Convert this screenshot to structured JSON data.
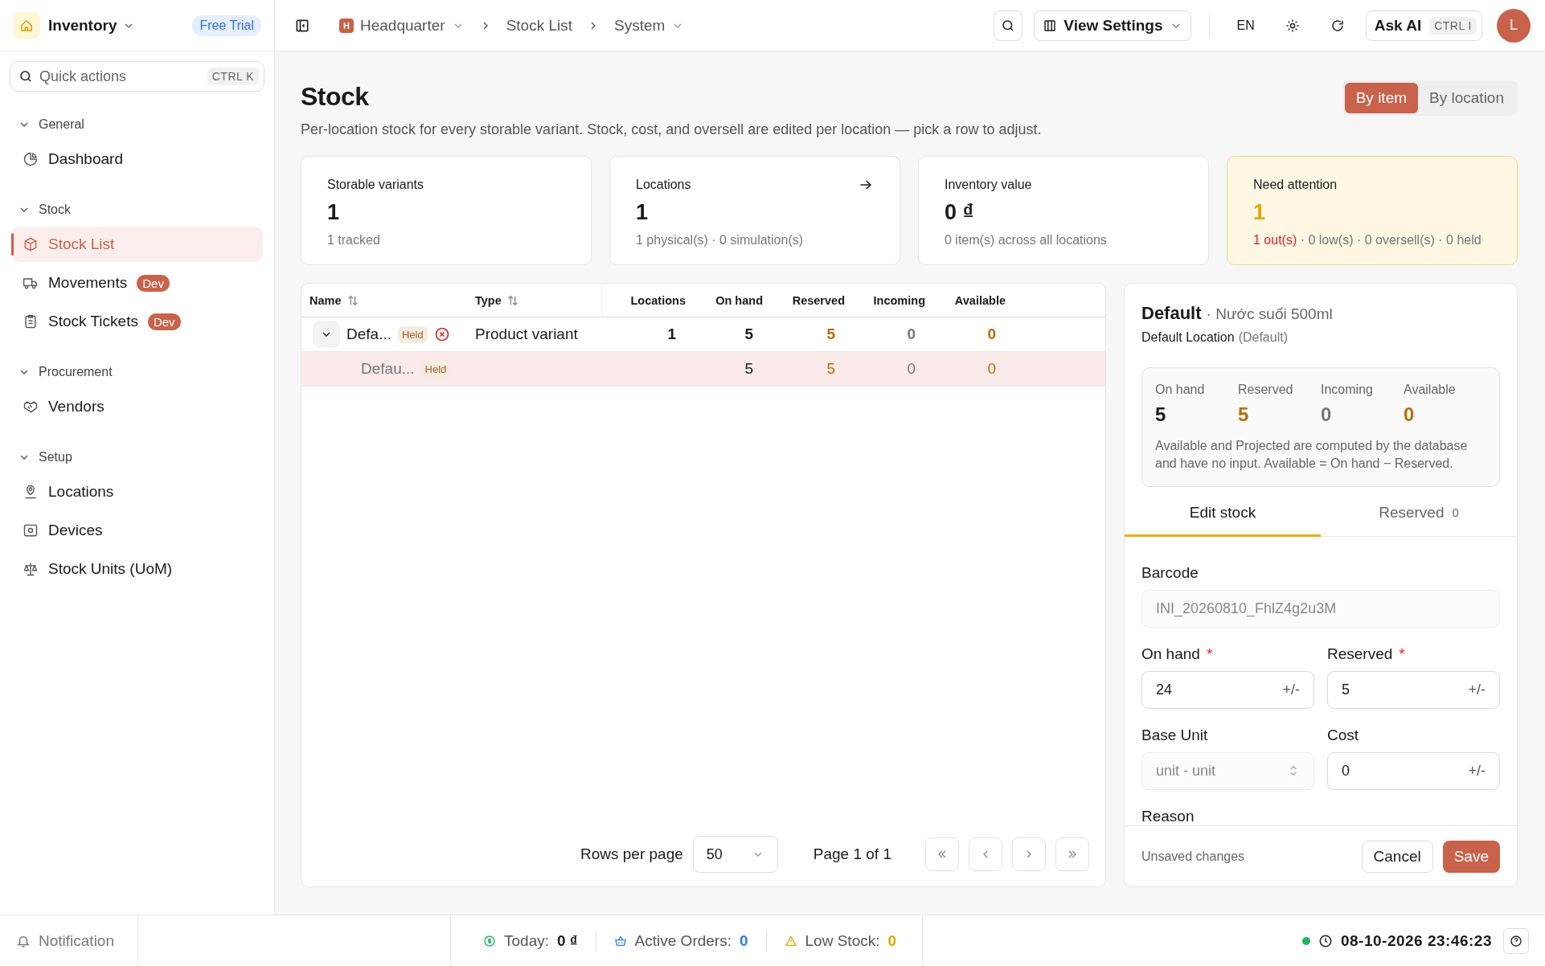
{
  "sidebar": {
    "app": {
      "name": "Inventory",
      "badge": "Free Trial"
    },
    "quick_actions": {
      "placeholder": "Quick actions",
      "shortcut": "CTRL K"
    },
    "sections": [
      {
        "title": "General",
        "expanded": true,
        "items": [
          {
            "label": "Dashboard",
            "selected": false
          }
        ]
      },
      {
        "title": "Stock",
        "expanded": true,
        "items": [
          {
            "label": "Stock List",
            "selected": true
          },
          {
            "label": "Movements",
            "badge": "Dev",
            "selected": false
          },
          {
            "label": "Stock Tickets",
            "badge": "Dev",
            "selected": false
          }
        ]
      },
      {
        "title": "Procurement",
        "expanded": true,
        "items": [
          {
            "label": "Vendors",
            "selected": false
          }
        ]
      },
      {
        "title": "Setup",
        "expanded": true,
        "items": [
          {
            "label": "Locations",
            "selected": false
          },
          {
            "label": "Devices",
            "selected": false
          },
          {
            "label": "Stock Units (UoM)",
            "selected": false
          }
        ]
      }
    ]
  },
  "topbar": {
    "breadcrumbs": [
      {
        "label": "Headquarter",
        "badge": "H",
        "dropdown": true
      },
      {
        "label": "Stock List",
        "dropdown": false
      },
      {
        "label": "System",
        "dropdown": true
      }
    ],
    "view_settings": "View Settings",
    "language": "EN",
    "ask_ai": {
      "label": "Ask AI",
      "shortcut": "CTRL I"
    },
    "avatar": "L"
  },
  "page": {
    "title": "Stock",
    "subtitle": "Per-location stock for every storable variant. Stock, cost, and oversell are edited per location — pick a row to adjust.",
    "view_toggle": [
      {
        "label": "By item",
        "selected": true
      },
      {
        "label": "By location",
        "selected": false
      }
    ]
  },
  "cards": [
    {
      "label": "Storable variants",
      "value": "1",
      "detail": "1 tracked",
      "link": false,
      "attention": false
    },
    {
      "label": "Locations",
      "value": "1",
      "detail": "1 physical(s) · 0 simulation(s)",
      "link": true,
      "attention": false
    },
    {
      "label": "Inventory value",
      "value": "0 ₫",
      "detail": "0 item(s) across all locations",
      "link": false,
      "attention": false
    },
    {
      "label": "Need attention",
      "value": "1",
      "alert": "1 out(s)",
      "detail": " · 0 low(s) · 0 oversell(s) · 0 held",
      "link": false,
      "attention": true
    }
  ],
  "table": {
    "columns": [
      {
        "label": "Name",
        "sortable": true
      },
      {
        "label": "Type",
        "sortable": true
      },
      {
        "label": "Locations",
        "sortable": false
      },
      {
        "label": "On hand",
        "sortable": false
      },
      {
        "label": "Reserved",
        "sortable": false
      },
      {
        "label": "Incoming",
        "sortable": false
      },
      {
        "label": "Available",
        "sortable": false
      }
    ],
    "rows": [
      {
        "name": "Defa...",
        "badge": "Held",
        "error": true,
        "expanded": true,
        "selected": false,
        "type": "Product variant",
        "locations": "1",
        "on_hand": "5",
        "reserved": "5",
        "incoming": "0",
        "available": "0",
        "children": [
          {
            "name": "Defau...",
            "badge": "Held",
            "error": false,
            "selected": true,
            "on_hand": "5",
            "reserved": "5",
            "incoming": "0",
            "available": "0"
          }
        ]
      }
    ],
    "pagination": {
      "rows_per_page_label": "Rows per page",
      "rows_per_page": "50",
      "page": "Page 1 of 1"
    }
  },
  "detail": {
    "title": "Default",
    "subtitle": "· Nước suối 500ml",
    "location": "Default Location",
    "location_note": "(Default)",
    "stats": [
      {
        "label": "On hand",
        "value": "5",
        "color": "#1a1a1a"
      },
      {
        "label": "Reserved",
        "value": "5",
        "color": "#b86e00"
      },
      {
        "label": "Incoming",
        "value": "0",
        "color": "#777777"
      },
      {
        "label": "Available",
        "value": "0",
        "color": "#b86e00"
      }
    ],
    "note": "Available and Projected are computed by the database and have no input. Available = On hand − Reserved.",
    "tabs": [
      {
        "label": "Edit stock",
        "selected": true
      },
      {
        "label": "Reserved",
        "count": "0",
        "selected": false
      }
    ],
    "fields": [
      {
        "kind": "text",
        "label": "Barcode",
        "value": "INI_20260810_FhlZ4g2u3M",
        "disabled": true
      },
      {
        "kind": "number",
        "label": "On hand",
        "required_mark": "*",
        "value": "24",
        "suffix": "+/-",
        "disabled": false
      },
      {
        "kind": "number",
        "label": "Reserved",
        "required_mark": "*",
        "value": "5",
        "suffix": "+/-",
        "disabled": false
      },
      {
        "kind": "select",
        "label": "Base Unit",
        "value": "unit - unit",
        "disabled": true
      },
      {
        "kind": "number",
        "label": "Cost",
        "value": "0",
        "suffix": "+/-",
        "disabled": false
      },
      {
        "kind": "heading",
        "label": "Reason"
      }
    ],
    "footer": {
      "status": "Unsaved changes",
      "cancel": "Cancel",
      "save": "Save"
    }
  },
  "status_bar": {
    "notification": "Notification",
    "stats": [
      {
        "label": "Today:",
        "value": "0 ₫",
        "color": "#22b35e",
        "highlight": false
      },
      {
        "label": "Active Orders:",
        "value": "0",
        "color": "#2f7fe0",
        "highlight": true
      },
      {
        "label": "Low Stock:",
        "value": "0",
        "color": "#e0a800",
        "highlight": true
      }
    ],
    "online": true,
    "time": "08-10-2026 23:46:23"
  }
}
